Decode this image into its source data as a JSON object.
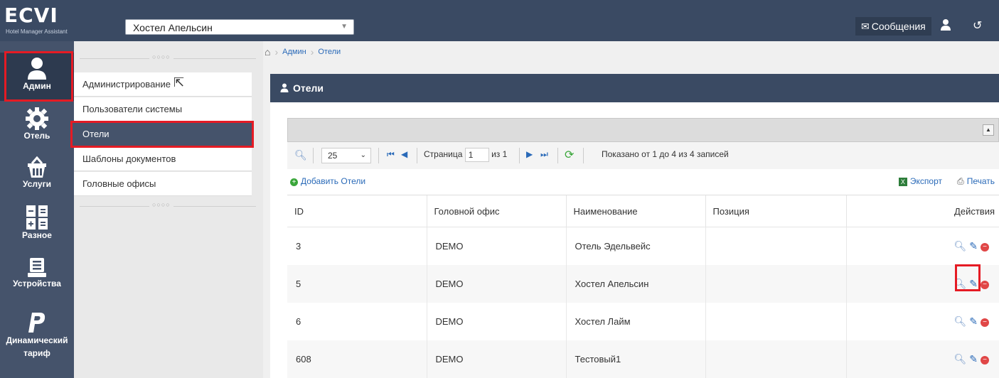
{
  "header": {
    "logo_text": "ECVI",
    "logo_subtitle": "Hotel Manager Assistant",
    "hotel_select": "Хостел Апельсин",
    "messages_label": "Сообщения"
  },
  "iconnav": [
    {
      "label": "Админ",
      "icon": "user-icon"
    },
    {
      "label": "Отель",
      "icon": "gear-icon"
    },
    {
      "label": "Услуги",
      "icon": "basket-icon"
    },
    {
      "label": "Разное",
      "icon": "calculator-icon"
    },
    {
      "label": "Устройства",
      "icon": "terminal-icon"
    },
    {
      "label": "Динамический тариф",
      "icon": "paypal-icon"
    }
  ],
  "submenu": [
    {
      "label": "Администрирование"
    },
    {
      "label": "Пользователи системы"
    },
    {
      "label": "Отели"
    },
    {
      "label": "Шаблоны документов"
    },
    {
      "label": "Головные офисы"
    }
  ],
  "breadcrumb": [
    "Админ",
    "Отели"
  ],
  "panel_title": "Отели",
  "pager": {
    "page_size": "25",
    "page_label": "Страница",
    "page_value": "1",
    "of_label": "из 1",
    "summary": "Показано от 1 до 4 из 4 записей"
  },
  "toolbar": {
    "add_label": "Добавить Отели",
    "export_label": "Экспорт",
    "print_label": "Печать"
  },
  "table": {
    "columns": [
      "ID",
      "Головной офис",
      "Наименование",
      "Позиция",
      "Действия"
    ],
    "rows": [
      {
        "id": "3",
        "office": "DEMO",
        "name": "Отель Эдельвейс",
        "position": ""
      },
      {
        "id": "5",
        "office": "DEMO",
        "name": "Хостел Апельсин",
        "position": ""
      },
      {
        "id": "6",
        "office": "DEMO",
        "name": "Хостел Лайм",
        "position": ""
      },
      {
        "id": "608",
        "office": "DEMO",
        "name": "Тестовый1",
        "position": ""
      }
    ]
  },
  "colors": {
    "header_bg": "#3a4a63",
    "nav_bg": "#45536b",
    "link": "#2a6ab8",
    "highlight": "#e51b24"
  }
}
